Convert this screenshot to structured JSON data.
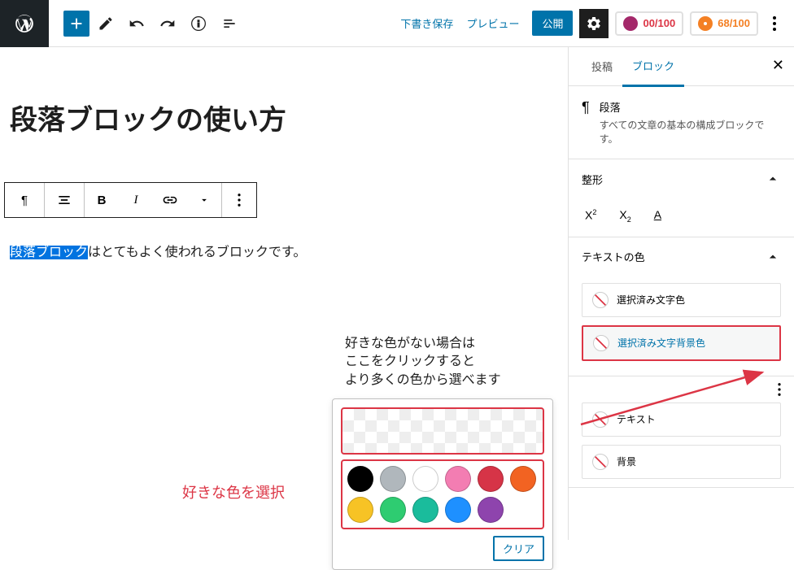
{
  "header": {
    "draft_save": "下書き保存",
    "preview": "プレビュー",
    "publish": "公開",
    "yoast_score": "00/100",
    "readability_score": "68/100"
  },
  "editor": {
    "post_title": "段落ブロックの使い方",
    "highlighted_text": "段落ブロック",
    "paragraph_rest": "はとてもよく使われるブロックです。"
  },
  "annotations": {
    "custom_color_note_line1": "好きな色がない場合は",
    "custom_color_note_line2": "ここをクリックすると",
    "custom_color_note_line3": "より多くの色から選べます",
    "swatch_note": "好きな色を選択"
  },
  "color_picker": {
    "clear": "クリア",
    "swatches": [
      "#000000",
      "#b0b7bc",
      "#ffffff",
      "#f37db2",
      "#d63447",
      "#f26322",
      "#f7c325",
      "#2ecc71",
      "#1abc9c",
      "#1e90ff",
      "#8e44ad",
      "transparent_hidden"
    ]
  },
  "sidebar": {
    "tabs": {
      "post": "投稿",
      "block": "ブロック"
    },
    "block_info": {
      "title": "段落",
      "desc": "すべての文章の基本の構成ブロックです。"
    },
    "panels": {
      "format": "整形",
      "text_color": "テキストの色",
      "text_color_option": "選択済み文字色",
      "bg_color_option": "選択済み文字背景色",
      "text_option": "テキスト",
      "bg_option": "背景"
    }
  }
}
